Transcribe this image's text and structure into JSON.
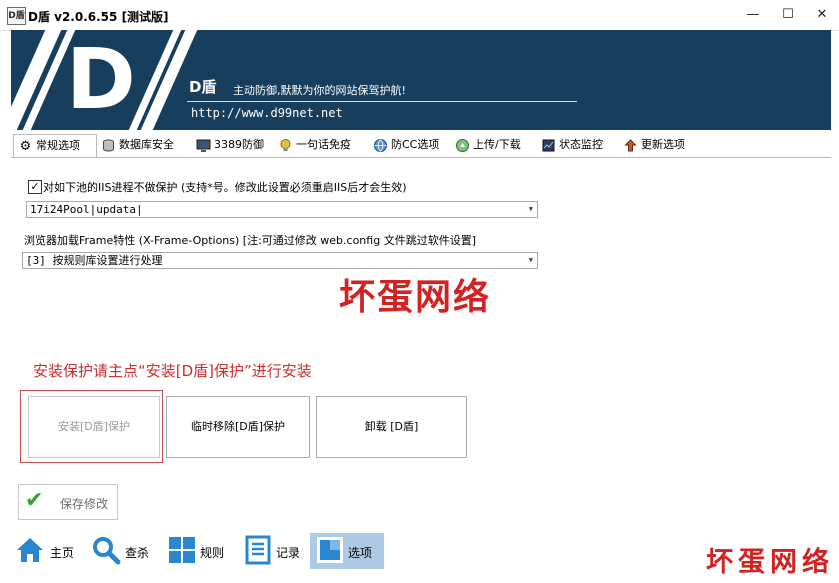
{
  "window": {
    "app_icon_text": "D盾",
    "title": "D盾 v2.0.6.55 [测试版]",
    "controls": {
      "minimize": "—",
      "maximize": "☐",
      "close": "✕"
    }
  },
  "banner": {
    "logo": "D",
    "brand": "D盾",
    "slogan": "主动防御,默默为你的网站保驾护航!",
    "url": "http://www.d99net.net"
  },
  "tabs": [
    {
      "label": "常规选项",
      "icon": "gear-icon",
      "active": true
    },
    {
      "label": "数据库安全",
      "icon": "database-icon"
    },
    {
      "label": "3389防御",
      "icon": "monitor-icon"
    },
    {
      "label": "一句话免疫",
      "icon": "bulb-icon"
    },
    {
      "label": "防CC选项",
      "icon": "globe-icon"
    },
    {
      "label": "上传/下载",
      "icon": "transfer-icon"
    },
    {
      "label": "状态监控",
      "icon": "status-icon"
    },
    {
      "label": "更新选项",
      "icon": "update-icon"
    }
  ],
  "settings": {
    "iis_pool_checkbox_label": "对如下池的IIS进程不做保护 (支持*号。修改此设置必须重启IIS后才会生效)",
    "iis_pool_checked": true,
    "iis_pool_value": "17i24Pool|updata|",
    "frame_label": "浏览器加载Frame特性 (X-Frame-Options) [注:可通过修改 web.config 文件跳过软件设置]",
    "frame_value": "[3] 按规则库设置进行处理"
  },
  "watermark": "坏蛋网络",
  "install_hint": "安装保护请主点“安装[D盾]保护”进行安装",
  "buttons": {
    "install": "安装[D盾]保护",
    "remove": "临时移除[D盾]保护",
    "uninstall": "卸载 [D盾]",
    "save": "保存修改"
  },
  "bottom_nav": [
    {
      "label": "主页",
      "icon": "home-icon"
    },
    {
      "label": "查杀",
      "icon": "magnifier-icon"
    },
    {
      "label": "规则",
      "icon": "grid-icon"
    },
    {
      "label": "记录",
      "icon": "list-icon"
    },
    {
      "label": "选项",
      "icon": "options-icon",
      "active": true
    }
  ],
  "corner_watermark": "坏蛋网络",
  "colors": {
    "banner": "#183e5e",
    "accent_red": "#d32222",
    "nav_active": "#aecbe6"
  }
}
